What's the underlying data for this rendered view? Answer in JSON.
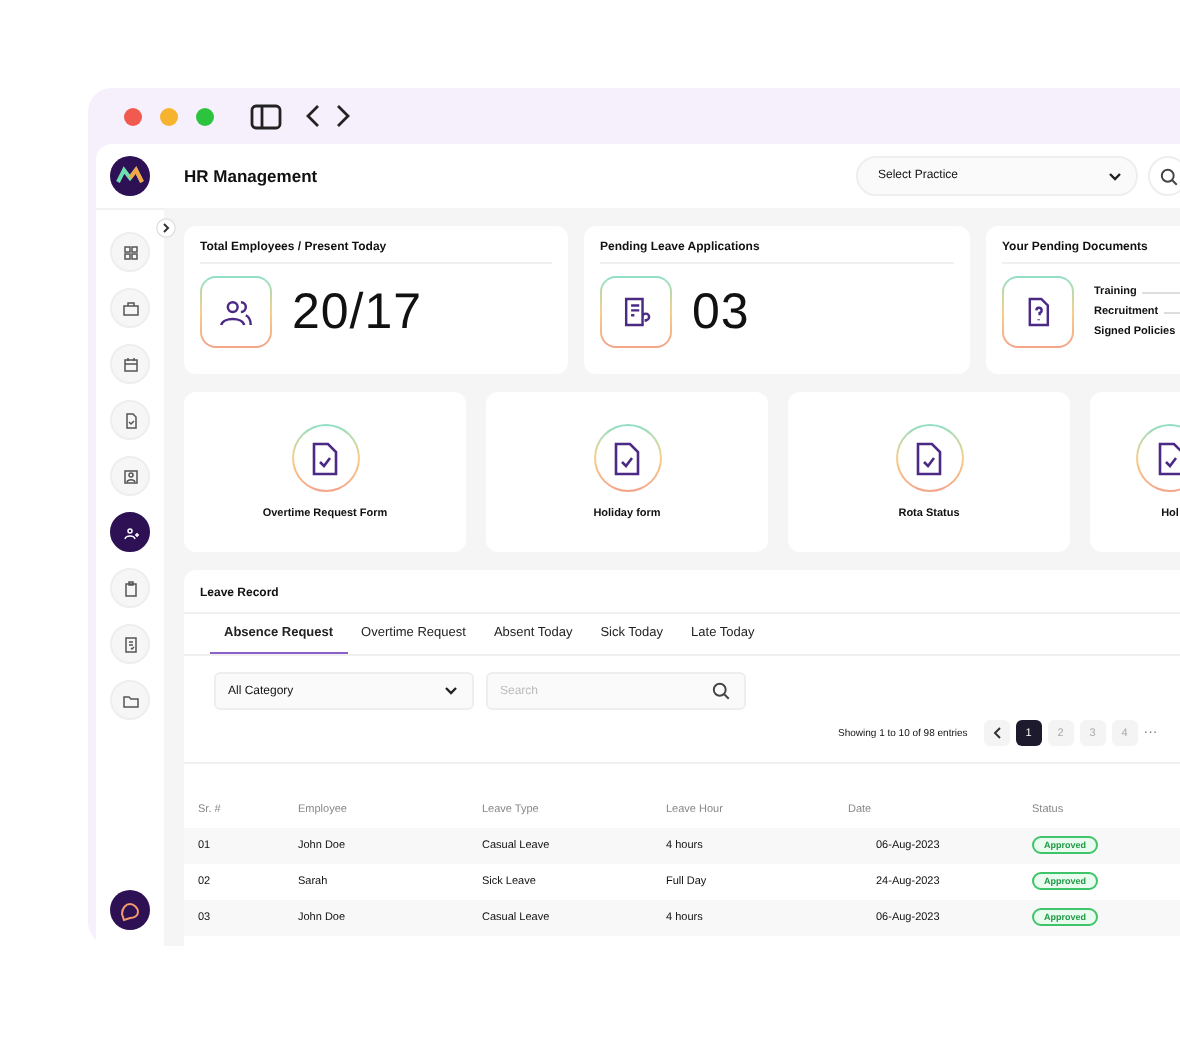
{
  "header": {
    "title": "HR Management",
    "practice_select": {
      "placeholder": "Select Practice"
    }
  },
  "sidebar": {
    "items": [
      {
        "selected": false
      },
      {
        "selected": false
      },
      {
        "selected": false
      },
      {
        "selected": false
      },
      {
        "selected": false
      },
      {
        "selected": true
      },
      {
        "selected": false
      },
      {
        "selected": false
      },
      {
        "selected": false
      }
    ]
  },
  "stats": [
    {
      "kind": "count",
      "title": "Total Employees / Present Today",
      "value": "20/17"
    },
    {
      "kind": "count",
      "title": "Pending Leave Applications",
      "value": "03"
    },
    {
      "kind": "documents",
      "title": "Your Pending Documents",
      "documents": [
        "Training",
        "Recruitment",
        "Signed Policies"
      ]
    }
  ],
  "quick_links": [
    "Overtime Request Form",
    "Holiday form",
    "Rota Status",
    "Hol"
  ],
  "leave_record": {
    "title": "Leave Record",
    "tabs": [
      {
        "label": "Absence Request",
        "selected": true
      },
      {
        "label": "Overtime Request",
        "selected": false
      },
      {
        "label": "Absent Today",
        "selected": false
      },
      {
        "label": "Sick Today",
        "selected": false
      },
      {
        "label": "Late Today",
        "selected": false
      }
    ],
    "category_select": {
      "value": "All Category"
    },
    "search": {
      "placeholder": "Search"
    },
    "summary": "Showing 1 to 10 of 98 entries",
    "pages": [
      {
        "label": "1",
        "selected": true
      },
      {
        "label": "2",
        "selected": false
      },
      {
        "label": "3",
        "selected": false
      },
      {
        "label": "4",
        "selected": false
      }
    ],
    "more": "···",
    "columns": [
      "Sr. #",
      "Employee",
      "Leave Type",
      "Leave Hour",
      "Date",
      "Status"
    ],
    "rows": [
      {
        "cells": [
          "01",
          "John Doe",
          "Casual Leave",
          "4 hours",
          "06-Aug-2023"
        ],
        "status": "Approved"
      },
      {
        "cells": [
          "02",
          "Sarah",
          "Sick Leave",
          "Full Day",
          "24-Aug-2023"
        ],
        "status": "Approved"
      },
      {
        "cells": [
          "03",
          "John Doe",
          "Casual Leave",
          "4 hours",
          "06-Aug-2023"
        ],
        "status": "Approved"
      }
    ]
  }
}
